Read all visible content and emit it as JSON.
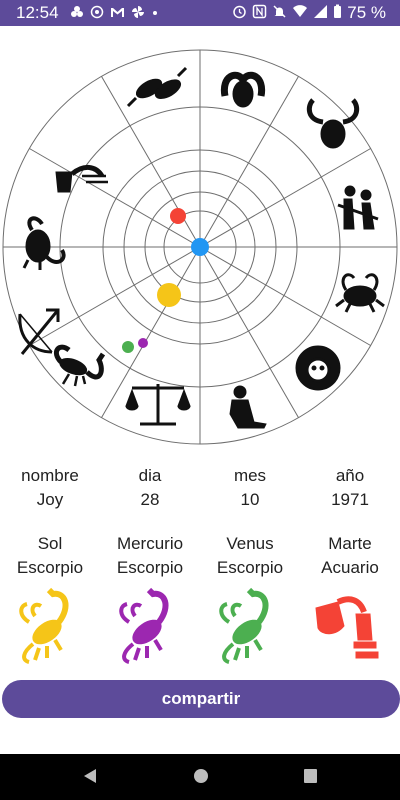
{
  "status_bar": {
    "time": "12:54",
    "battery": "75 %",
    "left_icons": [
      "photos-icon",
      "whatsapp-icon",
      "gmail-icon",
      "pinwheel-icon",
      "dot-icon"
    ],
    "right_icons": [
      "alarm-icon",
      "nfc-icon",
      "mute-icon",
      "wifi-icon",
      "signal-icon",
      "battery-icon"
    ]
  },
  "wheel": {
    "signs_clockwise_from_top": [
      "pisces",
      "aries",
      "taurus",
      "gemini",
      "cancer",
      "leo",
      "virgo",
      "libra",
      "scorpio",
      "sagittarius",
      "capricorn",
      "aquarius"
    ],
    "planet_colors": {
      "sun": "#f5c518",
      "mercury": "#9c27b0",
      "venus": "#4caf50",
      "mars": "#f44336",
      "earth": "#2196f3"
    }
  },
  "birth": {
    "labels": [
      "nombre",
      "dia",
      "mes",
      "año"
    ],
    "values": [
      "Joy",
      "28",
      "10",
      "1971"
    ]
  },
  "planets": [
    {
      "name": "Sol",
      "sign": "Escorpio",
      "icon": "scorpio-icon",
      "color": "#f5c518"
    },
    {
      "name": "Mercurio",
      "sign": "Escorpio",
      "icon": "scorpio-icon",
      "color": "#9c27b0"
    },
    {
      "name": "Venus",
      "sign": "Escorpio",
      "icon": "scorpio-icon",
      "color": "#4caf50"
    },
    {
      "name": "Marte",
      "sign": "Acuario",
      "icon": "aquarius-icon",
      "color": "#f44336"
    }
  ],
  "share_button": {
    "label": "compartir"
  },
  "nav": [
    "back-icon",
    "home-icon",
    "recents-icon"
  ],
  "theme": {
    "accent": "#5d4b9a"
  }
}
